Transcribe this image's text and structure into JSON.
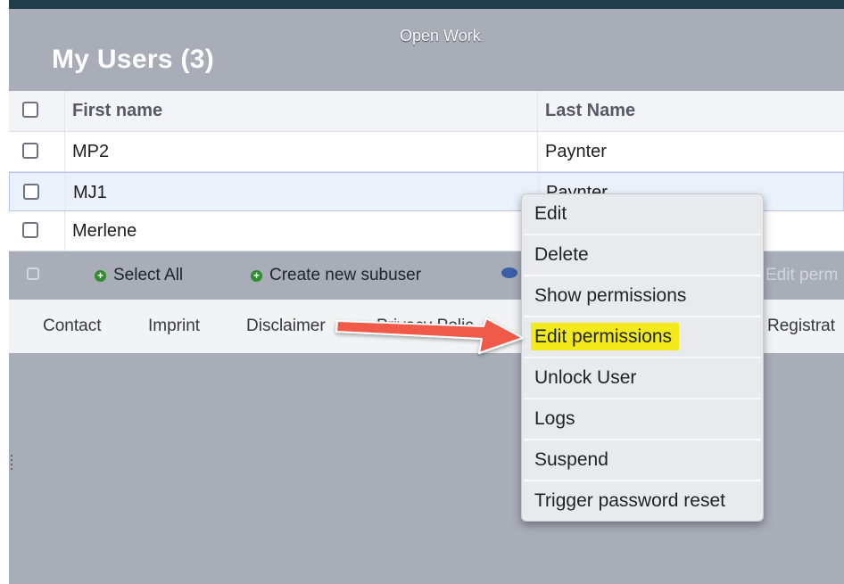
{
  "header": {
    "overlay_title": "Open Work",
    "page_title": "My Users (3)"
  },
  "table": {
    "columns": [
      "First name",
      "Last Name"
    ],
    "rows": [
      {
        "first_name": "MP2",
        "last_name": "Paynter"
      },
      {
        "first_name": "MJ1",
        "last_name": "Paynter"
      },
      {
        "first_name": "Merlene",
        "last_name": ""
      }
    ]
  },
  "toolbar": {
    "select_all": "Select All",
    "create_subuser": "Create new subuser",
    "edit_permissions_faded": "Edit perm"
  },
  "footer": {
    "links": [
      "Contact",
      "Imprint",
      "Disclaimer",
      "Privacy Polic",
      "Registrat"
    ]
  },
  "context_menu": {
    "items": [
      "Edit",
      "Delete",
      "Show permissions",
      "Edit permissions",
      "Unlock User",
      "Logs",
      "Suspend",
      "Trigger password reset"
    ],
    "highlighted_item": "Edit permissions"
  },
  "colors": {
    "highlight": "#f2ea1a",
    "arrow": "#f05a4a",
    "background": "#a9adb8",
    "plus_icon": "#2f8c2f"
  }
}
